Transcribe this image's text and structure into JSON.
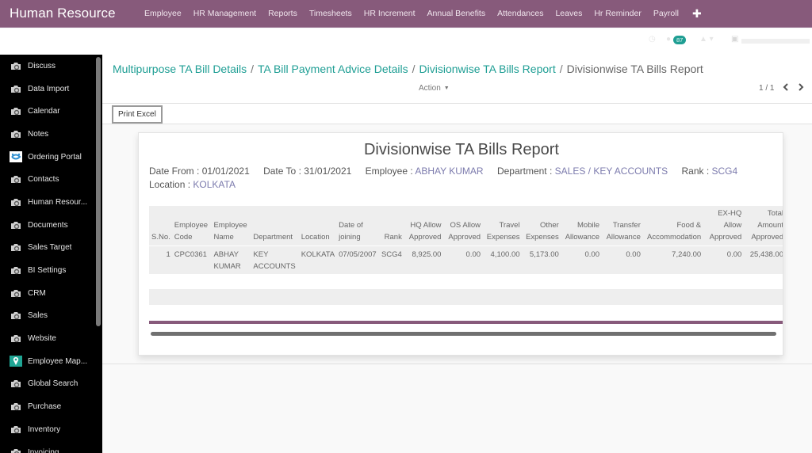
{
  "app": {
    "title": "Human Resource"
  },
  "topnav": {
    "menu": [
      "Employee",
      "HR Management",
      "Reports",
      "Timesheets",
      "HR Increment",
      "Annual Benefits",
      "Attendances",
      "Leaves",
      "Hr Reminder",
      "Payroll"
    ],
    "add_icon": "plus-icon"
  },
  "systray": {
    "messages_count": "87"
  },
  "sidebar": {
    "items": [
      {
        "label": "Discuss",
        "icon": "camera-icon"
      },
      {
        "label": "Data Import",
        "icon": "camera-icon"
      },
      {
        "label": "Calendar",
        "icon": "camera-icon"
      },
      {
        "label": "Notes",
        "icon": "camera-icon"
      },
      {
        "label": "Ordering Portal",
        "icon": "handshake-icon"
      },
      {
        "label": "Contacts",
        "icon": "camera-icon"
      },
      {
        "label": "Human Resour...",
        "icon": "camera-icon"
      },
      {
        "label": "Documents",
        "icon": "camera-icon"
      },
      {
        "label": "Sales Target",
        "icon": "camera-icon"
      },
      {
        "label": "BI Settings",
        "icon": "camera-icon"
      },
      {
        "label": "CRM",
        "icon": "camera-icon"
      },
      {
        "label": "Sales",
        "icon": "camera-icon"
      },
      {
        "label": "Website",
        "icon": "camera-icon"
      },
      {
        "label": "Employee Map...",
        "icon": "map-pin-icon"
      },
      {
        "label": "Global Search",
        "icon": "camera-icon"
      },
      {
        "label": "Purchase",
        "icon": "camera-icon"
      },
      {
        "label": "Inventory",
        "icon": "camera-icon"
      },
      {
        "label": "Invoicing",
        "icon": "camera-icon"
      }
    ]
  },
  "breadcrumb": {
    "links": [
      "Multipurpose TA Bill Details",
      "TA Bill Payment Advice Details",
      "Divisionwise TA Bills Report"
    ],
    "separator": "/",
    "current": "Divisionwise TA Bills Report"
  },
  "control": {
    "action_label": "Action",
    "pager": "1 / 1",
    "prev": "‹",
    "next": "›"
  },
  "buttons": {
    "print_excel": "Print Excel"
  },
  "report": {
    "title": "Divisionwise TA Bills Report",
    "filters": [
      {
        "label": "Date From : ",
        "value": "01/01/2021",
        "highlight": false
      },
      {
        "label": "Date To : ",
        "value": "31/01/2021",
        "highlight": false
      },
      {
        "label": "Employee : ",
        "value": "ABHAY KUMAR",
        "highlight": true
      },
      {
        "label": "Department : ",
        "value": "SALES / KEY ACCOUNTS",
        "highlight": true
      },
      {
        "label": "Rank : ",
        "value": "SCG4",
        "highlight": true
      },
      {
        "label": "Location : ",
        "value": "KOLKATA",
        "highlight": true
      }
    ],
    "columns": [
      {
        "label": "S.No.",
        "align": "l"
      },
      {
        "label": "Employee Code",
        "align": "l"
      },
      {
        "label": "Employee Name",
        "align": "l"
      },
      {
        "label": "Department",
        "align": "l"
      },
      {
        "label": "Location",
        "align": "l"
      },
      {
        "label": "Date of joining",
        "align": "l"
      },
      {
        "label": "Rank",
        "align": "r"
      },
      {
        "label": "HQ Allow Approved",
        "align": "r"
      },
      {
        "label": "OS Allow Approved",
        "align": "r"
      },
      {
        "label": "Travel Expenses",
        "align": "r"
      },
      {
        "label": "Other Expenses",
        "align": "r"
      },
      {
        "label": "Mobile Allowance",
        "align": "r"
      },
      {
        "label": "Transfer Allowance",
        "align": "r"
      },
      {
        "label": "Food & Accommodation",
        "align": "r"
      },
      {
        "label": "EX-HQ Allow Approved",
        "align": "r"
      },
      {
        "label": "Total Amount Approved",
        "align": "r"
      }
    ],
    "rows": [
      [
        "1",
        "CPC0361",
        "ABHAY KUMAR",
        "KEY ACCOUNTS",
        "KOLKATA",
        "07/05/2007",
        "SCG4",
        "8,925.00",
        "0.00",
        "4,100.00",
        "5,173.00",
        "0.00",
        "0.00",
        "7,240.00",
        "0.00",
        "25,438.00"
      ]
    ]
  },
  "colors": {
    "brand": "#875a7b",
    "link": "#1e9e94",
    "filter_value": "#7c7bad",
    "badge": "#1f9e93"
  }
}
